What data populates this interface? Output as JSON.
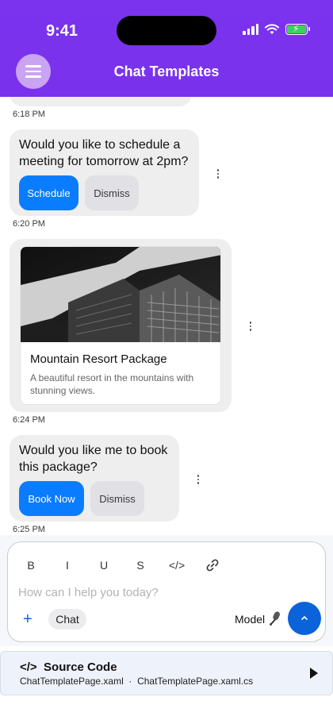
{
  "status_bar": {
    "time": "9:41"
  },
  "header": {
    "title": "Chat Templates",
    "menu_icon": "hamburger-icon"
  },
  "messages": {
    "m0_time": "6:18 PM",
    "m1": {
      "text": "Would you like to schedule a meeting for tomorrow at 2pm?",
      "primary": "Schedule",
      "secondary": "Dismiss",
      "time": "6:20 PM"
    },
    "m2": {
      "card_title": "Mountain Resort Package",
      "card_desc": "A beautiful resort in the mountains with stunning views.",
      "time": "6:24 PM"
    },
    "m3": {
      "text": "Would you like me to book this package?",
      "primary": "Book Now",
      "secondary": "Dismiss",
      "time": "6:25 PM"
    }
  },
  "composer": {
    "format_bold": "B",
    "format_italic": "I",
    "format_underline": "U",
    "format_strike": "S",
    "format_code": "</>",
    "placeholder": "How can I help you today?",
    "add_symbol": "+",
    "chip_label": "Chat",
    "model_label": "Model",
    "send_icon": "chevron-up-icon"
  },
  "source_code": {
    "icon": "</>",
    "title": "Source Code",
    "files": "ChatTemplatePage.xaml  ·  ChatTemplatePage.xaml.cs"
  },
  "colors": {
    "header": "#7b33ee",
    "accent": "#0a7cff",
    "send": "#0a63d8",
    "bubble": "#eeeeee"
  }
}
